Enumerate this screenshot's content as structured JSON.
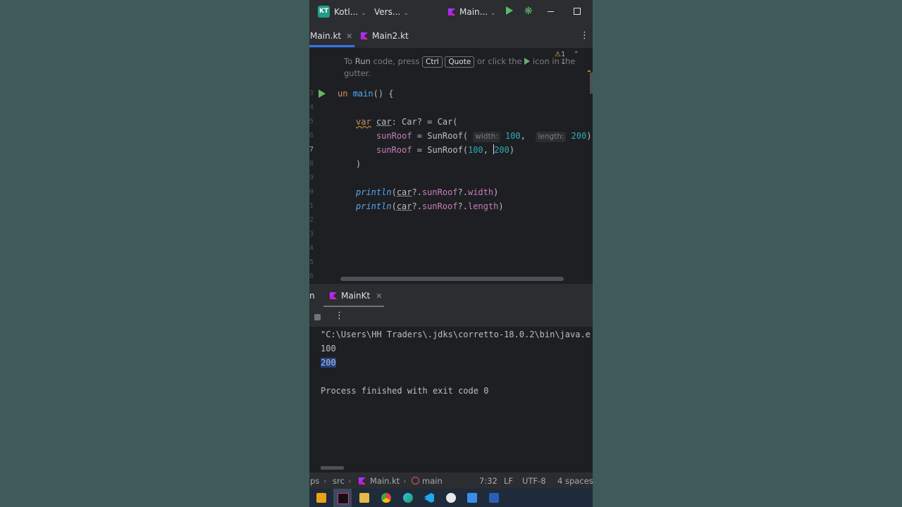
{
  "titlebar": {
    "project_badge": "KT",
    "project_name": "Kotl...",
    "vcs": "Vers...",
    "run_config": "Main..."
  },
  "tabs": [
    {
      "label": "Main.kt",
      "active": true
    },
    {
      "label": "Main2.kt",
      "active": false
    }
  ],
  "editor": {
    "hint": {
      "pre": "To ",
      "run": "Run",
      "mid": " code, press ",
      "key1": "Ctrl",
      "key2": "Quote",
      "post": " or click the ",
      "post2": " icon in the",
      "line2": "gutter."
    },
    "warning_count": "1",
    "line_numbers": [
      "3",
      "4",
      "5",
      "6",
      "7",
      "8",
      "9",
      "0",
      "1",
      "2",
      "3",
      "4",
      "5",
      "6"
    ],
    "inlay_width": "width:",
    "inlay_length": "length:"
  },
  "run_panel": {
    "left_label": "n",
    "tab_label": "MainKt",
    "output": [
      "\"C:\\Users\\HH Traders\\.jdks\\corretto-18.0.2\\bin\\java.e",
      "100",
      "200",
      "",
      "Process finished with exit code 0"
    ]
  },
  "statusbar": {
    "crumb1": "ps",
    "crumb2": "src",
    "crumb3": "Main.kt",
    "crumb4": "main",
    "position": "7:32",
    "line_sep": "LF",
    "encoding": "UTF-8",
    "indent": "4 spaces"
  },
  "colors": {
    "accent": "#3574f0",
    "run_green": "#5fb865",
    "selection": "#214283"
  }
}
